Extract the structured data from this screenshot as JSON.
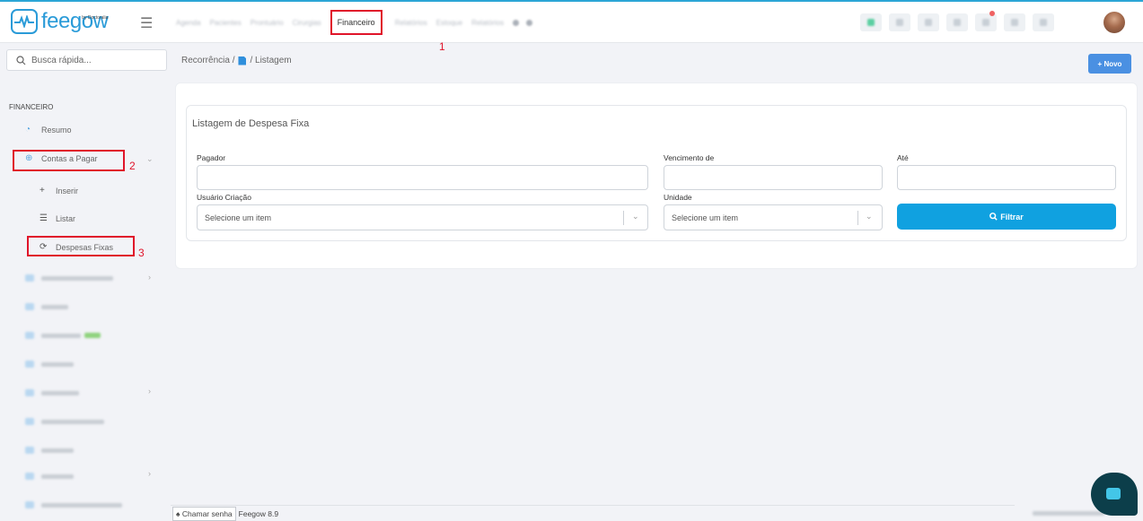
{
  "header": {
    "logo_text": "feegow",
    "logo_sub": "by Doctoralia",
    "nav_items": [
      "Agenda",
      "Pacientes",
      "Prontuário",
      "Cirurgias",
      "Financeiro",
      "Relatórios",
      "Estoque",
      "Relatórios"
    ],
    "active_nav": "Financeiro",
    "annotation_1": "1"
  },
  "sidebar": {
    "search_placeholder": "Busca rápida...",
    "section_title": "FINANCEIRO",
    "items": [
      {
        "label": "Resumo",
        "icon": "pie-chart-icon"
      },
      {
        "label": "Contas a Pagar",
        "icon": "circle-plus-icon"
      },
      {
        "label": "Inserir",
        "icon": "plus-icon"
      },
      {
        "label": "Listar",
        "icon": "list-icon"
      },
      {
        "label": "Despesas Fixas",
        "icon": "refresh-icon"
      }
    ],
    "annotation_2": "2",
    "annotation_3": "3"
  },
  "main": {
    "breadcrumb_1": "Recorrência /",
    "breadcrumb_2": "/ Listagem",
    "new_button": "+ Novo",
    "panel_title": "Listagem de Despesa Fixa",
    "fields": {
      "pagador_label": "Pagador",
      "vencimento_label": "Vencimento de",
      "ate_label": "Até",
      "usuario_label": "Usuário Criação",
      "unidade_label": "Unidade",
      "usuario_value": "Selecione um item",
      "unidade_value": "Selecione um item"
    },
    "filter_button": "Filtrar"
  },
  "footer": {
    "chamar_senha": "Chamar senha",
    "version": "Feegow 8.9"
  },
  "colors": {
    "brand": "#2a9bd8",
    "annotation_red": "#e0142a",
    "filter_button": "#10a1e0",
    "new_button": "#4a90e2"
  }
}
